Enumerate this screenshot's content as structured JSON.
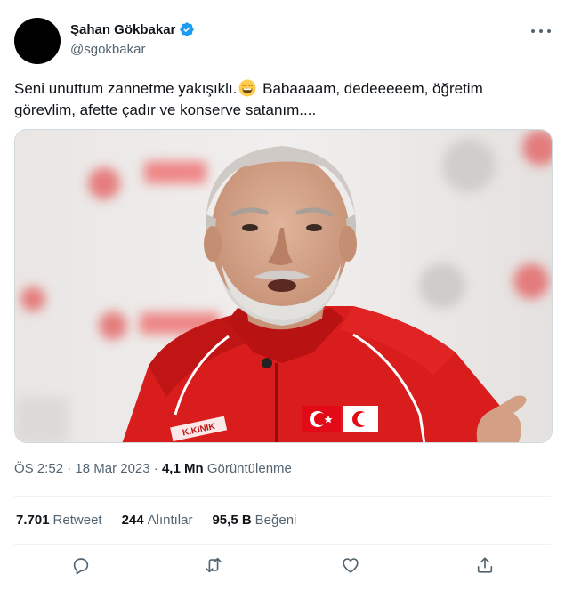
{
  "author": {
    "display_name": "Şahan Gökbakar",
    "handle": "@sgokbakar",
    "verified": true,
    "avatar_color": "#000000",
    "verified_color": "#1d9bf0"
  },
  "tweet": {
    "text_before_emoji": "Seni unuttum zannetme yakışıklı.",
    "emoji": "grinning-face-with-smiling-eyes",
    "text_after_emoji": " Babaaaam, dedeeeeem, öğretim görevlim, afette çadır ve konserve satanım....",
    "media": {
      "type": "photo",
      "jersey_badge_text": "K.KINIK"
    }
  },
  "meta": {
    "time": "ÖS 2:52",
    "separator": "·",
    "date": "18 Mar 2023",
    "views_value": "4,1 Mn",
    "views_label": "Görüntülenme"
  },
  "stats": {
    "retweets_value": "7.701",
    "retweets_label": "Retweet",
    "quotes_value": "244",
    "quotes_label": "Alıntılar",
    "likes_value": "95,5 B",
    "likes_label": "Beğeni"
  },
  "actions": [
    "reply-icon",
    "retweet-icon",
    "like-icon",
    "share-icon"
  ],
  "colors": {
    "text_primary": "#0f1419",
    "text_secondary": "#536471",
    "divider": "#eff3f4",
    "jersey_red": "#d91c1c"
  }
}
